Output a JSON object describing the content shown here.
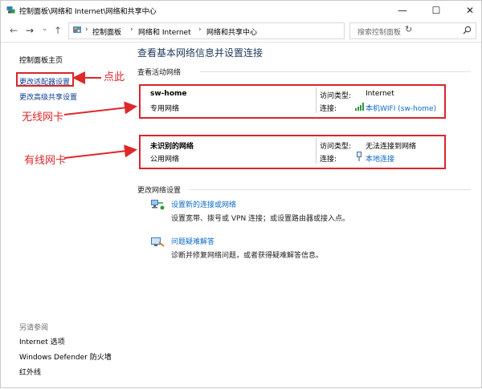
{
  "window": {
    "title": "控制面板\\网络和 Internet\\网络和共享中心",
    "minimize": "—",
    "maximize": "☐",
    "close": "✕"
  },
  "nav": {
    "back": "←",
    "forward": "→",
    "recent": "⌄",
    "up": "↑",
    "breadcrumbs": [
      "控制面板",
      "网络和 Internet",
      "网络和共享中心"
    ],
    "separator": "›",
    "dropdown": "⌄",
    "refresh": "↻",
    "search_placeholder": "搜索控制面板"
  },
  "sidebar": {
    "home": "控制面板主页",
    "adapter": "更改适配器设置",
    "sharing": "更改高级共享设置",
    "see_also_heading": "另请参阅",
    "see_also": [
      "Internet 选项",
      "Windows Defender 防火墙",
      "红外线"
    ]
  },
  "annotations": {
    "click_here": "点此",
    "wireless": "无线网卡",
    "wired": "有线网卡",
    "color": "#e0272a"
  },
  "main": {
    "title": "查看基本网络信息并设置连接",
    "active_heading": "查看活动网络",
    "networks": [
      {
        "name": "sw-home",
        "category": "专用网络",
        "access_label": "访问类型:",
        "access_value": "Internet",
        "conn_label": "连接:",
        "conn_value": "本机WIFI (sw-home)",
        "conn_icon": "wifi-signal-icon"
      },
      {
        "name": "未识别的网络",
        "category": "公用网络",
        "access_label": "访问类型:",
        "access_value": "无法连接到网络",
        "conn_label": "连接:",
        "conn_value": "本地连接",
        "conn_icon": "ethernet-icon"
      }
    ],
    "change_heading": "更改网络设置",
    "tasks": [
      {
        "icon": "new-connection-icon",
        "link": "设置新的连接或网络",
        "desc": "设置宽带、拨号或 VPN 连接；或设置路由器或接入点。"
      },
      {
        "icon": "troubleshoot-icon",
        "link": "问题疑难解答",
        "desc": "诊断并修复网络问题，或者获得疑难解答信息。"
      }
    ]
  },
  "colors": {
    "link": "#0b6ac7",
    "title": "#1e395b",
    "highlight_border": "#d9262a"
  }
}
